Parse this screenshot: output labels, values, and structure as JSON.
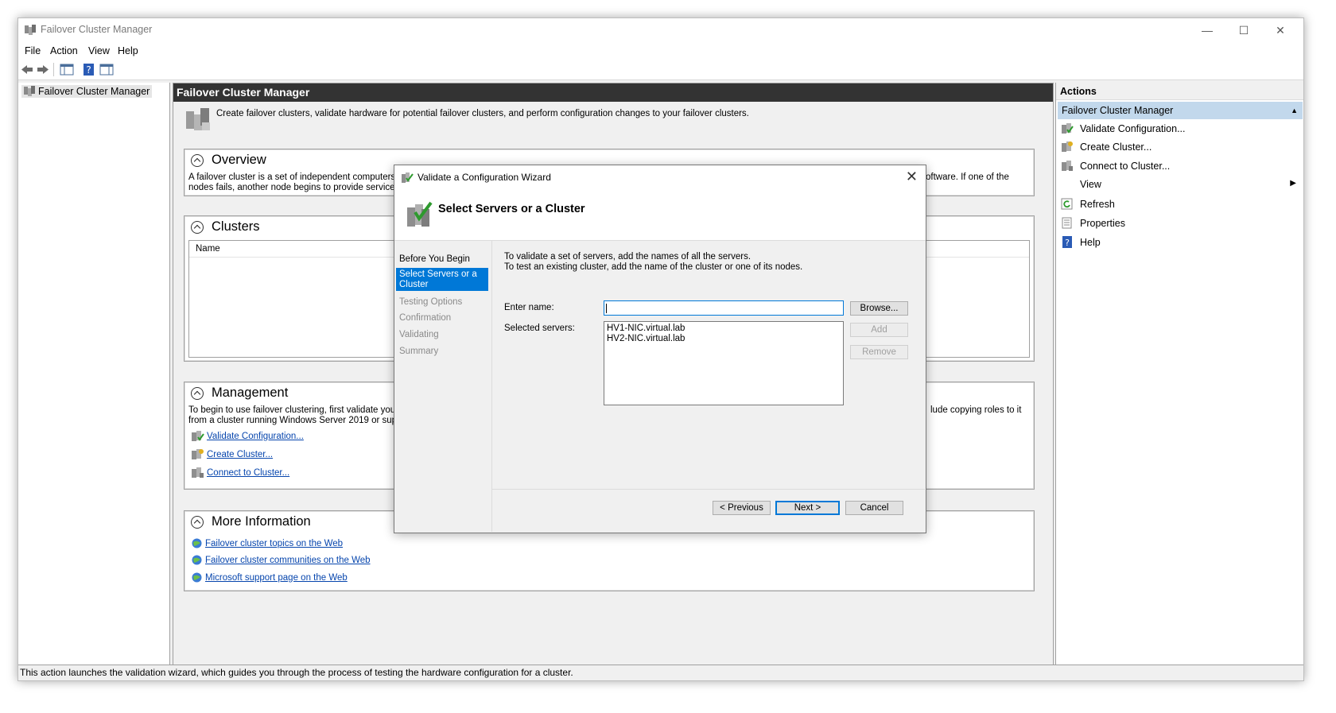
{
  "window": {
    "title": "Failover Cluster Manager",
    "controls": {
      "minimize": "—",
      "maximize": "☐",
      "close": "✕"
    }
  },
  "menu": [
    "File",
    "Action",
    "View",
    "Help"
  ],
  "tree": {
    "root_label": "Failover Cluster Manager"
  },
  "center": {
    "header": "Failover Cluster Manager",
    "intro": "Create failover clusters, validate hardware for potential failover clusters, and perform configuration changes to your failover clusters.",
    "overview": {
      "title": "Overview",
      "text_left_1": "A failover cluster is a set of independent computers tha",
      "text_left_2": "nodes fails, another node begins to provide services. T",
      "text_right_1": "oftware. If one of the"
    },
    "clusters": {
      "title": "Clusters",
      "column_name": "Name"
    },
    "management": {
      "title": "Management",
      "text_left_1": "To begin to use failover clustering, first validate your h",
      "text_left_2": "from a cluster running Windows Server 2019 or suppo",
      "text_right_1": "lude copying roles to it",
      "links": [
        "Validate Configuration...",
        "Create Cluster...",
        "Connect to Cluster..."
      ]
    },
    "more_info": {
      "title": "More Information",
      "links": [
        "Failover cluster topics on the Web",
        "Failover cluster communities on the Web",
        "Microsoft support page on the Web"
      ]
    }
  },
  "actions": {
    "header": "Actions",
    "group": "Failover Cluster Manager",
    "items": [
      "Validate Configuration...",
      "Create Cluster...",
      "Connect to Cluster...",
      "View",
      "Refresh",
      "Properties",
      "Help"
    ]
  },
  "status_bar": "This action launches the validation wizard, which guides you through the process of testing the hardware configuration for a cluster.",
  "wizard": {
    "title": "Validate a Configuration Wizard",
    "heading": "Select Servers or a Cluster",
    "steps": [
      {
        "label": "Before You Begin",
        "state": "done"
      },
      {
        "label": "Select Servers or a Cluster",
        "state": "active"
      },
      {
        "label": "Testing Options",
        "state": "pending"
      },
      {
        "label": "Confirmation",
        "state": "pending"
      },
      {
        "label": "Validating",
        "state": "pending"
      },
      {
        "label": "Summary",
        "state": "pending"
      }
    ],
    "instructions_1": "To validate a set of servers, add the names of all the servers.",
    "instructions_2": "To test an existing cluster, add the name of the cluster or one of its nodes.",
    "enter_name_label": "Enter name:",
    "enter_name_value": "",
    "selected_servers_label": "Selected servers:",
    "selected_servers": [
      "HV1-NIC.virtual.lab",
      "HV2-NIC.virtual.lab"
    ],
    "buttons": {
      "browse": "Browse...",
      "add": "Add",
      "remove": "Remove",
      "previous": "< Previous",
      "next": "Next >",
      "cancel": "Cancel"
    }
  },
  "colors": {
    "accent": "#0078d7",
    "header_dark": "#333333",
    "action_group": "#c2d8ec",
    "link": "#0645ad"
  }
}
